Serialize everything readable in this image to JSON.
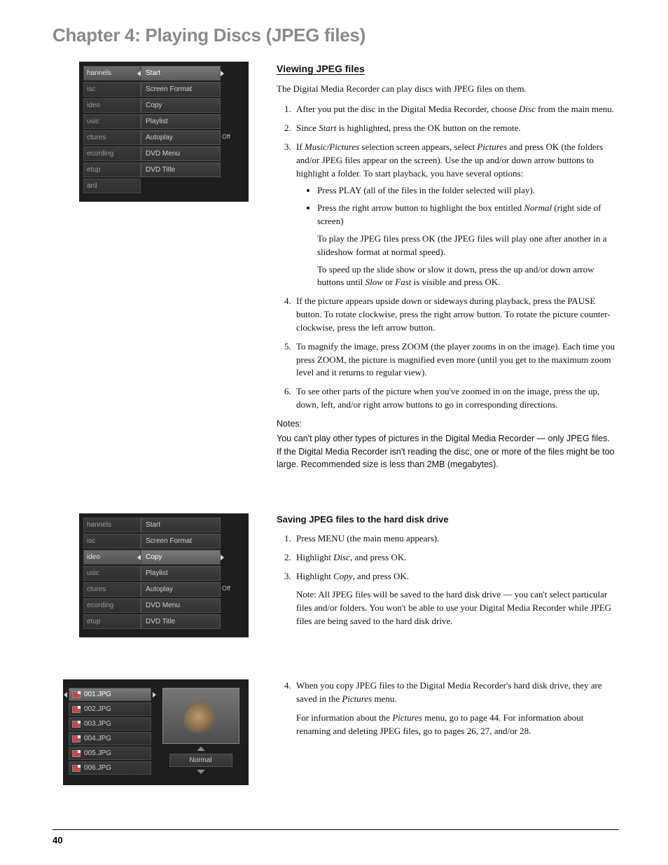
{
  "chapter_title": "Chapter 4: Playing Discs (JPEG files)",
  "page_number": "40",
  "shot1": {
    "left": [
      "hannels",
      "isc",
      "ideo",
      "usic",
      "ctures",
      "ecording",
      "etup",
      "ard"
    ],
    "right": [
      "Start",
      "Screen Format",
      "Copy",
      "Playlist",
      "Autoplay",
      "DVD Menu",
      "DVD Title"
    ],
    "autoplay_val": "Off",
    "selected_index": 0
  },
  "shot2": {
    "left": [
      "hannels",
      "isc",
      "ideo",
      "usic",
      "ctures",
      "ecording",
      "etup"
    ],
    "right": [
      "Start",
      "Screen Format",
      "Copy",
      "Playlist",
      "Autoplay",
      "DVD Menu",
      "DVD Title"
    ],
    "autoplay_val": "Off",
    "selected_index": 2
  },
  "browser": {
    "files": [
      "001.JPG",
      "002.JPG",
      "003.JPG",
      "004.JPG",
      "005.JPG",
      "006.JPG"
    ],
    "mode": "Normal"
  },
  "section1": {
    "heading": "Viewing JPEG files",
    "intro": "The Digital Media Recorder can play discs with JPEG files on them.",
    "step1_a": "After you put the disc in the Digital Media Recorder, choose ",
    "step1_i": "Disc",
    "step1_b": " from the main menu.",
    "step2_a": "Since ",
    "step2_i": "Start",
    "step2_b": " is highlighted, press the OK button on the remote.",
    "step3_a": "If ",
    "step3_i1": "Music/Pictures",
    "step3_b": " selection screen appears, select ",
    "step3_i2": "Pictures",
    "step3_c": " and press OK (the folders and/or JPEG files appear on the screen). Use the up and/or down arrow buttons to highlight a folder. To start playback, you have several options:",
    "b1": "Press PLAY (all of the files in the folder selected will play).",
    "b2_a": "Press the right arrow button to highlight the box entitled ",
    "b2_i": "Normal",
    "b2_b": " (right side of screen)",
    "b2p1": "To play the JPEG files press OK (the JPEG files will play one after another in a slideshow format at normal speed).",
    "b2p2_a": "To speed up the slide show or slow it down, press the up and/or down arrow buttons until ",
    "b2p2_i1": "Slow",
    "b2p2_m": " or ",
    "b2p2_i2": "Fast",
    "b2p2_b": " is visible and press OK.",
    "step4": "If the picture appears upside down or sideways during playback, press the PAUSE button. To rotate clockwise, press the right arrow button. To rotate the picture counter-clockwise, press the left arrow button.",
    "step5": "To magnify the image, press ZOOM (the player zooms in on the image). Each time you press ZOOM, the picture is magnified even more (until you get to the maximum zoom level and it returns to regular view).",
    "step6": "To see other parts of the picture when you've zoomed in on the image, press the up, down, left, and/or right arrow buttons to go in corresponding directions.",
    "notes_h": "Notes:",
    "note1": "You can't play other types of pictures in the Digital Media Recorder — only JPEG files.",
    "note2": "If the Digital Media Recorder isn't reading the disc, one or more of the files might be too large. Recommended size is less than 2MB (megabytes)."
  },
  "section2": {
    "heading": "Saving JPEG files to the hard disk drive",
    "s1": "Press MENU (the main menu appears).",
    "s2_a": "Highlight ",
    "s2_i": "Disc",
    "s2_b": ", and press OK.",
    "s3_a": "Highlight ",
    "s3_i": "Copy",
    "s3_b": ", and press OK.",
    "note": "Note: All JPEG files will be saved to the hard disk drive — you can't select particular files and/or folders. You won't be able to use your Digital Media Recorder while JPEG files are being saved to the hard disk drive."
  },
  "section3": {
    "s4_a": "When you copy JPEG files to the Digital Media Recorder's hard disk drive, they are saved in the ",
    "s4_i": "Pictures",
    "s4_b": " menu.",
    "p_a": "For information about the ",
    "p_i": "Pictures",
    "p_b": " menu, go to page 44. For information about renaming and deleting JPEG files, go to pages 26, 27, and/or 28."
  }
}
